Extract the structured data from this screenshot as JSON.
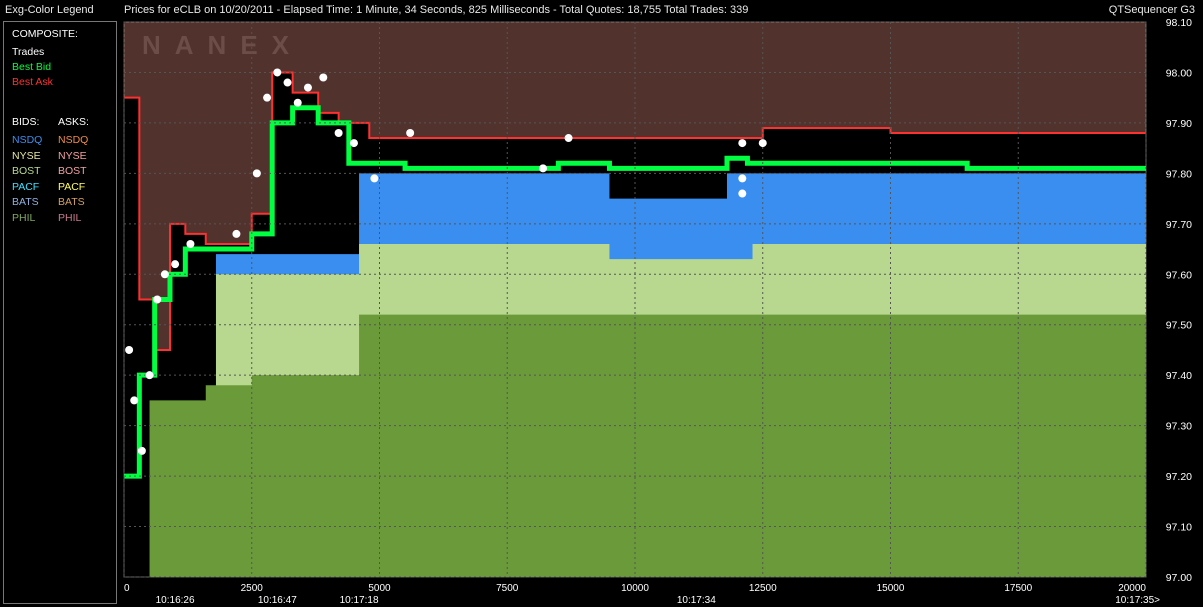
{
  "header": {
    "legend_title": "Exg-Color Legend",
    "chart_title": "Prices for  eCLB  on  10/20/2011  -  Elapsed Time: 1 Minute, 34 Seconds, 825 Milliseconds  -  Total Quotes: 18,755  Total Trades: 339",
    "app_name": "QTSequencer G3"
  },
  "legend": {
    "composite_label": "COMPOSITE:",
    "trades_label": "Trades",
    "best_bid_label": "Best Bid",
    "best_ask_label": "Best Ask",
    "bids_label": "BIDS:",
    "asks_label": "ASKS:",
    "exchanges": [
      {
        "bid": "NSDQ",
        "ask": "NSDQ",
        "bid_color": "#3a8ef0",
        "ask_color": "#f08a4a"
      },
      {
        "bid": "NYSE",
        "ask": "NYSE",
        "bid_color": "#e6e6a0",
        "ask_color": "#f4a0a0"
      },
      {
        "bid": "BOST",
        "ask": "BOST",
        "bid_color": "#b8d890",
        "ask_color": "#f0a0a0"
      },
      {
        "bid": "PACF",
        "ask": "PACF",
        "bid_color": "#40e0ff",
        "ask_color": "#ffff60"
      },
      {
        "bid": "BATS",
        "ask": "BATS",
        "bid_color": "#90b0e0",
        "ask_color": "#d4a060"
      },
      {
        "bid": "PHIL",
        "ask": "PHIL",
        "bid_color": "#80a860",
        "ask_color": "#c87890"
      }
    ],
    "colors": {
      "trades": "#ffffff",
      "best_bid": "#00ff40",
      "best_ask": "#ff3030",
      "composite": "#ffffff"
    }
  },
  "chart_data": {
    "type": "area",
    "title": "",
    "xlim": [
      0,
      20000
    ],
    "ylim": [
      97.0,
      98.1
    ],
    "x_ticks": [
      0,
      2500,
      5000,
      7500,
      10000,
      12500,
      15000,
      17500,
      20000
    ],
    "x_tick_labels": [
      "0",
      "2500",
      "5000",
      "7500",
      "10000",
      "12500",
      "15000",
      "17500",
      "20000"
    ],
    "time_ticks": [
      {
        "x": 1000,
        "label": "10:16:26"
      },
      {
        "x": 3000,
        "label": "10:16:47"
      },
      {
        "x": 4600,
        "label": "10:17:18"
      },
      {
        "x": 11200,
        "label": "10:17:34"
      },
      {
        "x": 19900,
        "label": "10:17:35>"
      }
    ],
    "y_ticks": [
      97.0,
      97.1,
      97.2,
      97.3,
      97.4,
      97.5,
      97.6,
      97.7,
      97.8,
      97.9,
      98.0,
      98.1
    ],
    "y_tick_labels": [
      "97.00",
      "97.10",
      "97.20",
      "97.30",
      "97.40",
      "97.50",
      "97.60",
      "97.70",
      "97.80",
      "97.90",
      "98.00",
      "98.10"
    ],
    "grid": true,
    "watermark": "NANEX",
    "series": [
      {
        "name": "Best Ask",
        "color": "#ff3030",
        "x": [
          0,
          300,
          600,
          900,
          1200,
          1600,
          2200,
          2500,
          2900,
          3300,
          3800,
          4200,
          4800,
          11800,
          12500,
          15000,
          17500,
          20000
        ],
        "y": [
          97.95,
          97.55,
          97.45,
          97.7,
          97.68,
          97.66,
          97.66,
          97.72,
          98.0,
          97.96,
          97.92,
          97.9,
          97.87,
          97.87,
          97.89,
          97.88,
          97.88,
          97.88
        ]
      },
      {
        "name": "Best Bid",
        "color": "#00ff40",
        "x": [
          0,
          300,
          600,
          900,
          1200,
          1600,
          2500,
          2900,
          3300,
          3800,
          4400,
          4800,
          5500,
          8500,
          9500,
          11800,
          12200,
          15000,
          16500,
          20000
        ],
        "y": [
          97.2,
          97.4,
          97.55,
          97.6,
          97.65,
          97.65,
          97.68,
          97.9,
          97.93,
          97.9,
          97.82,
          97.82,
          97.81,
          97.82,
          97.81,
          97.83,
          97.82,
          97.82,
          97.81,
          97.81
        ]
      },
      {
        "name": "NSDQ",
        "color": "#3a8ef0",
        "x": [
          1800,
          2500,
          4600,
          5000,
          9500,
          11800,
          20000
        ],
        "y": [
          97.64,
          97.64,
          97.8,
          97.8,
          97.75,
          97.8,
          97.8
        ]
      },
      {
        "name": "BOST",
        "color": "#b8d890",
        "x": [
          1800,
          2500,
          4600,
          8300,
          9500,
          12300,
          20000
        ],
        "y": [
          97.6,
          97.6,
          97.66,
          97.66,
          97.63,
          97.66,
          97.66
        ]
      },
      {
        "name": "PHIL",
        "color": "#6b9a3a",
        "x": [
          500,
          1600,
          2500,
          4600,
          5000,
          20000
        ],
        "y": [
          97.35,
          97.38,
          97.4,
          97.52,
          97.52,
          97.52
        ]
      }
    ],
    "trades": [
      {
        "x": 100,
        "y": 97.45
      },
      {
        "x": 200,
        "y": 97.35
      },
      {
        "x": 350,
        "y": 97.25
      },
      {
        "x": 500,
        "y": 97.4
      },
      {
        "x": 650,
        "y": 97.55
      },
      {
        "x": 800,
        "y": 97.6
      },
      {
        "x": 1000,
        "y": 97.62
      },
      {
        "x": 1300,
        "y": 97.66
      },
      {
        "x": 2200,
        "y": 97.68
      },
      {
        "x": 2600,
        "y": 97.8
      },
      {
        "x": 2800,
        "y": 97.95
      },
      {
        "x": 3000,
        "y": 98.0
      },
      {
        "x": 3200,
        "y": 97.98
      },
      {
        "x": 3400,
        "y": 97.94
      },
      {
        "x": 3600,
        "y": 97.97
      },
      {
        "x": 3900,
        "y": 97.99
      },
      {
        "x": 4200,
        "y": 97.88
      },
      {
        "x": 4500,
        "y": 97.86
      },
      {
        "x": 4900,
        "y": 97.79
      },
      {
        "x": 5600,
        "y": 97.88
      },
      {
        "x": 8200,
        "y": 97.81
      },
      {
        "x": 8700,
        "y": 97.87
      },
      {
        "x": 12100,
        "y": 97.86
      },
      {
        "x": 12500,
        "y": 97.86
      },
      {
        "x": 12100,
        "y": 97.76
      },
      {
        "x": 12100,
        "y": 97.79
      }
    ]
  }
}
